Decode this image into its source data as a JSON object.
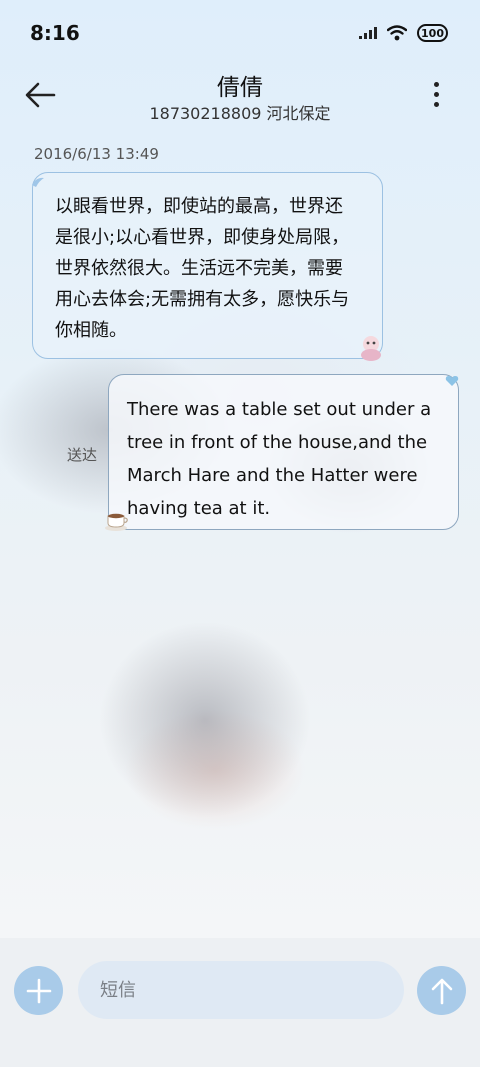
{
  "status": {
    "time": "8:16",
    "battery": "100"
  },
  "header": {
    "contact_name": "倩倩",
    "contact_info": "18730218809 河北保定"
  },
  "conversation": {
    "timestamp": "2016/6/13 13:49",
    "messages": [
      {
        "direction": "incoming",
        "text": "以眼看世界，即使站的最高，世界还是很小;以心看世界，即使身处局限，世界依然很大。生活远不完美，需要用心去体会;无需拥有太多，愿快乐与你相随。"
      },
      {
        "direction": "outgoing",
        "text": "There was a table set out under a tree in front of the house,and the March Hare and the Hatter were having tea at it.",
        "status": "送达"
      }
    ]
  },
  "composer": {
    "placeholder": "短信"
  },
  "colors": {
    "accent": "#a9cbe9",
    "bubble_border": "#9cc1e2"
  }
}
